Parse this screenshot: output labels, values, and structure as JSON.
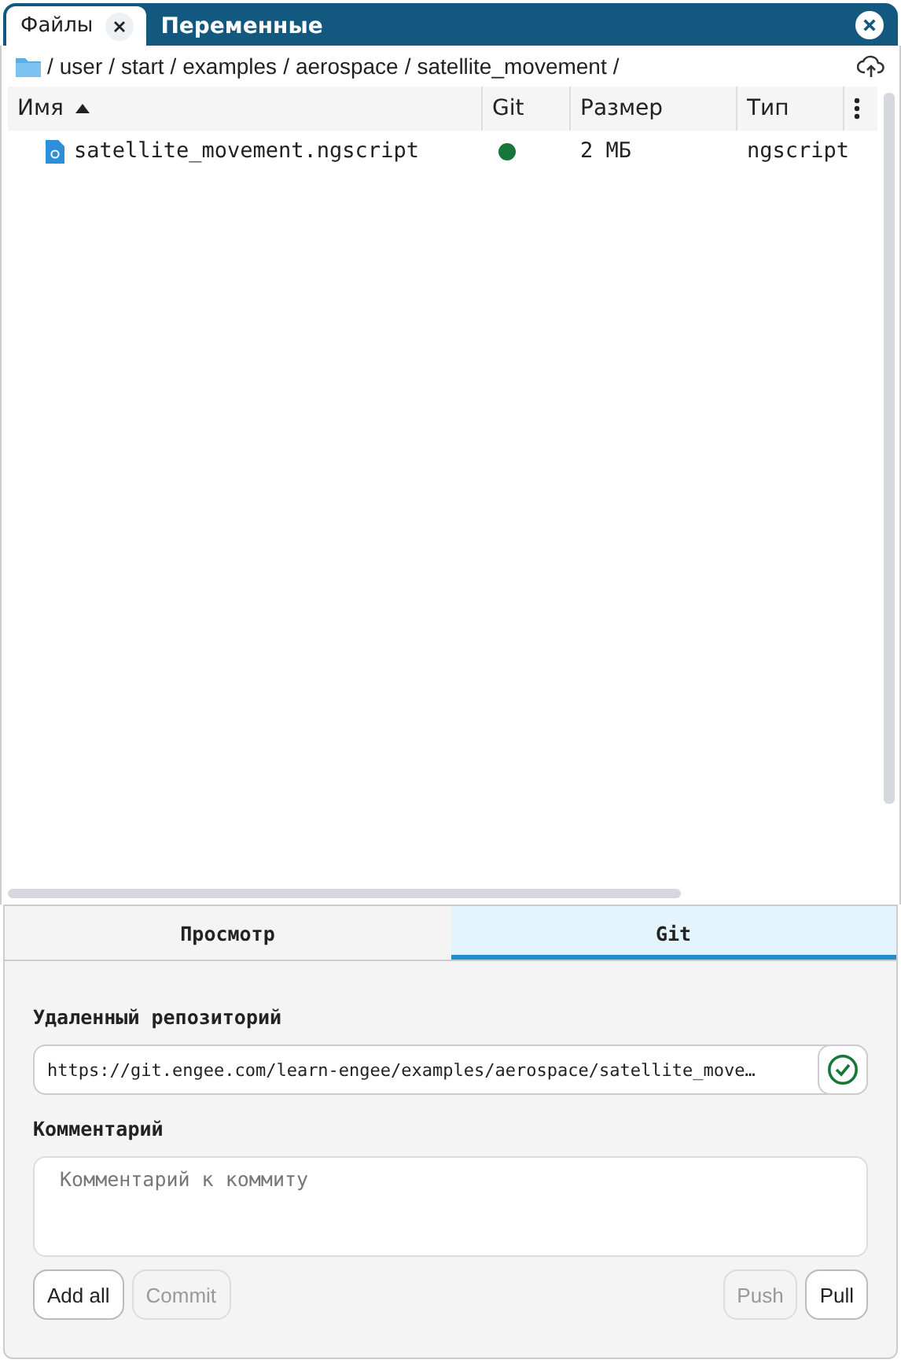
{
  "tabs": [
    {
      "label": "Файлы",
      "selected": true,
      "closable": true
    },
    {
      "label": "Переменные",
      "selected": false,
      "closable": false
    }
  ],
  "breadcrumb": [
    "/",
    "user",
    "/",
    "start",
    "/",
    "examples",
    "/",
    "aerospace",
    "/",
    "satellite_movement",
    "/"
  ],
  "table": {
    "columns": [
      {
        "label": "Имя",
        "sorted": true
      },
      {
        "label": "Git",
        "sorted": false
      },
      {
        "label": "Размер",
        "sorted": false
      },
      {
        "label": "Тип",
        "sorted": false
      }
    ],
    "rows": [
      {
        "name": "satellite_movement.ngscript",
        "color": "#17773a",
        "size": "2 МБ",
        "type": "ngscript"
      }
    ]
  },
  "panel_tabs": [
    {
      "label": "Просмотр",
      "selected": false
    },
    {
      "label": "Git",
      "selected": true
    }
  ],
  "git": {
    "remote_label": "Удаленный репозиторий",
    "remote_value": "https://git.engee.com/learn-engee/examples/aerospace/satellite_move…",
    "remote_verified": true,
    "comment_label": "Комментарий",
    "comment_placeholder": "Комментарий к коммиту",
    "left_buttons": [
      {
        "label": "Add all",
        "disabled": false
      },
      {
        "label": "Commit",
        "disabled": true
      }
    ],
    "right_buttons": [
      {
        "label": "Push",
        "disabled": true
      },
      {
        "label": "Pull",
        "disabled": false
      }
    ]
  }
}
